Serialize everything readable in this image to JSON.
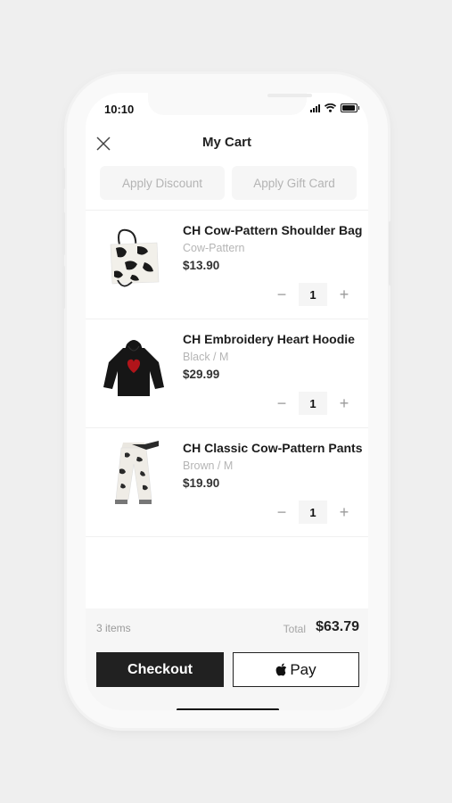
{
  "status_bar": {
    "time": "10:10"
  },
  "header": {
    "title": "My Cart"
  },
  "actions": {
    "discount_label": "Apply Discount",
    "gift_card_label": "Apply Gift Card"
  },
  "items": [
    {
      "name": "CH Cow-Pattern Shoulder Bag",
      "variant": "Cow-Pattern",
      "price": "$13.90",
      "quantity": "1"
    },
    {
      "name": "CH Embroidery Heart Hoodie",
      "variant": "Black / M",
      "price": "$29.99",
      "quantity": "1"
    },
    {
      "name": "CH Classic Cow-Pattern Pants",
      "variant": "Brown / M",
      "price": "$19.90",
      "quantity": "1"
    }
  ],
  "summary": {
    "count": "3 items",
    "total_label": "Total",
    "total": "$63.79"
  },
  "buttons": {
    "checkout_label": "Checkout",
    "apple_pay_label": "Pay"
  },
  "icons": {
    "close": "close-icon",
    "minus": "minus-icon",
    "plus": "plus-icon",
    "apple": "apple-logo-icon"
  }
}
